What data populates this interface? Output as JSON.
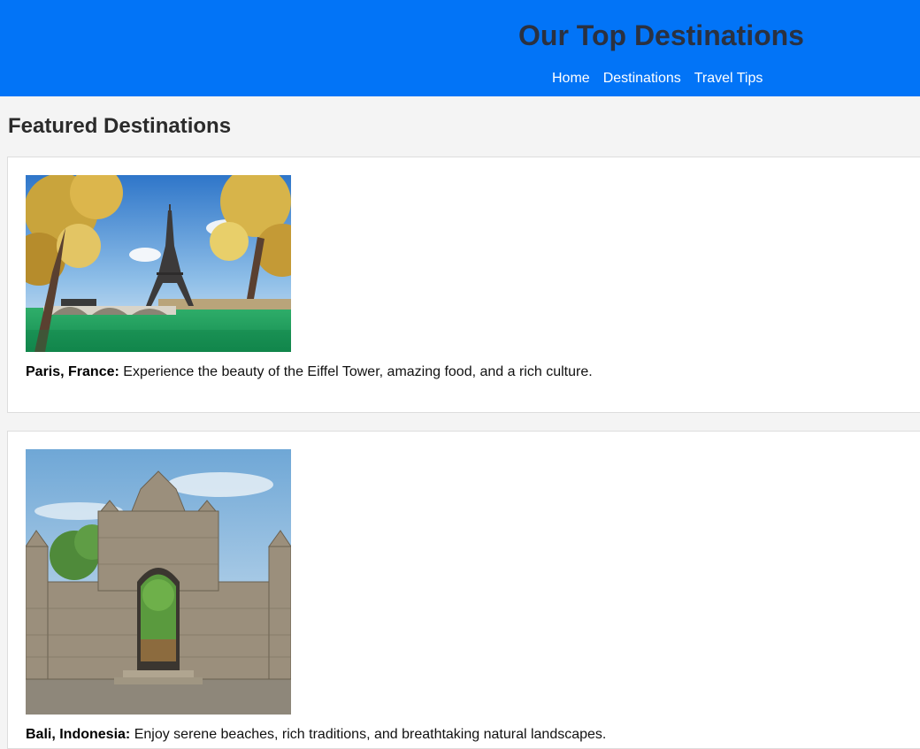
{
  "header": {
    "title": "Our Top Destinations",
    "nav": [
      "Home",
      "Destinations",
      "Travel Tips"
    ],
    "background_color": "#0274f7",
    "title_color": "#2b3140"
  },
  "main": {
    "section_title": "Featured Destinations",
    "destinations": [
      {
        "name": "Paris, France:",
        "description": " Experience the beauty of the Eiffel Tower, amazing food, and a rich culture.",
        "image_subject": "Eiffel Tower with autumn trees and the Seine river"
      },
      {
        "name": "Bali, Indonesia:",
        "description": " Enjoy serene beaches, rich traditions, and breathtaking natural landscapes.",
        "image_subject": "Balinese stone temple gate"
      }
    ]
  }
}
